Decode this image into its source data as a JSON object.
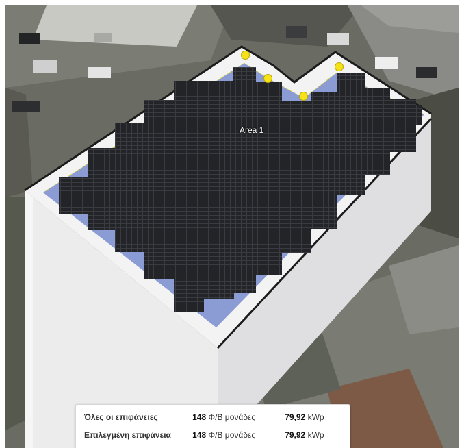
{
  "roof": {
    "area_label": "Area 1"
  },
  "summary": {
    "rows": [
      {
        "label": "Όλες οι επιφάνειες",
        "count": "148",
        "count_unit": "Φ/Β μονάδες",
        "power": "79,92",
        "power_unit": "kWp"
      },
      {
        "label": "Επιλεγμένη επιφάνεια",
        "count": "148",
        "count_unit": "Φ/Β μονάδες",
        "power": "79,92",
        "power_unit": "kWp"
      }
    ]
  },
  "colors": {
    "panel": "#222326",
    "roof_surface": "#8b9bd4",
    "vertex_handle": "#f5e21b",
    "parapet": "#e9e9ea"
  }
}
